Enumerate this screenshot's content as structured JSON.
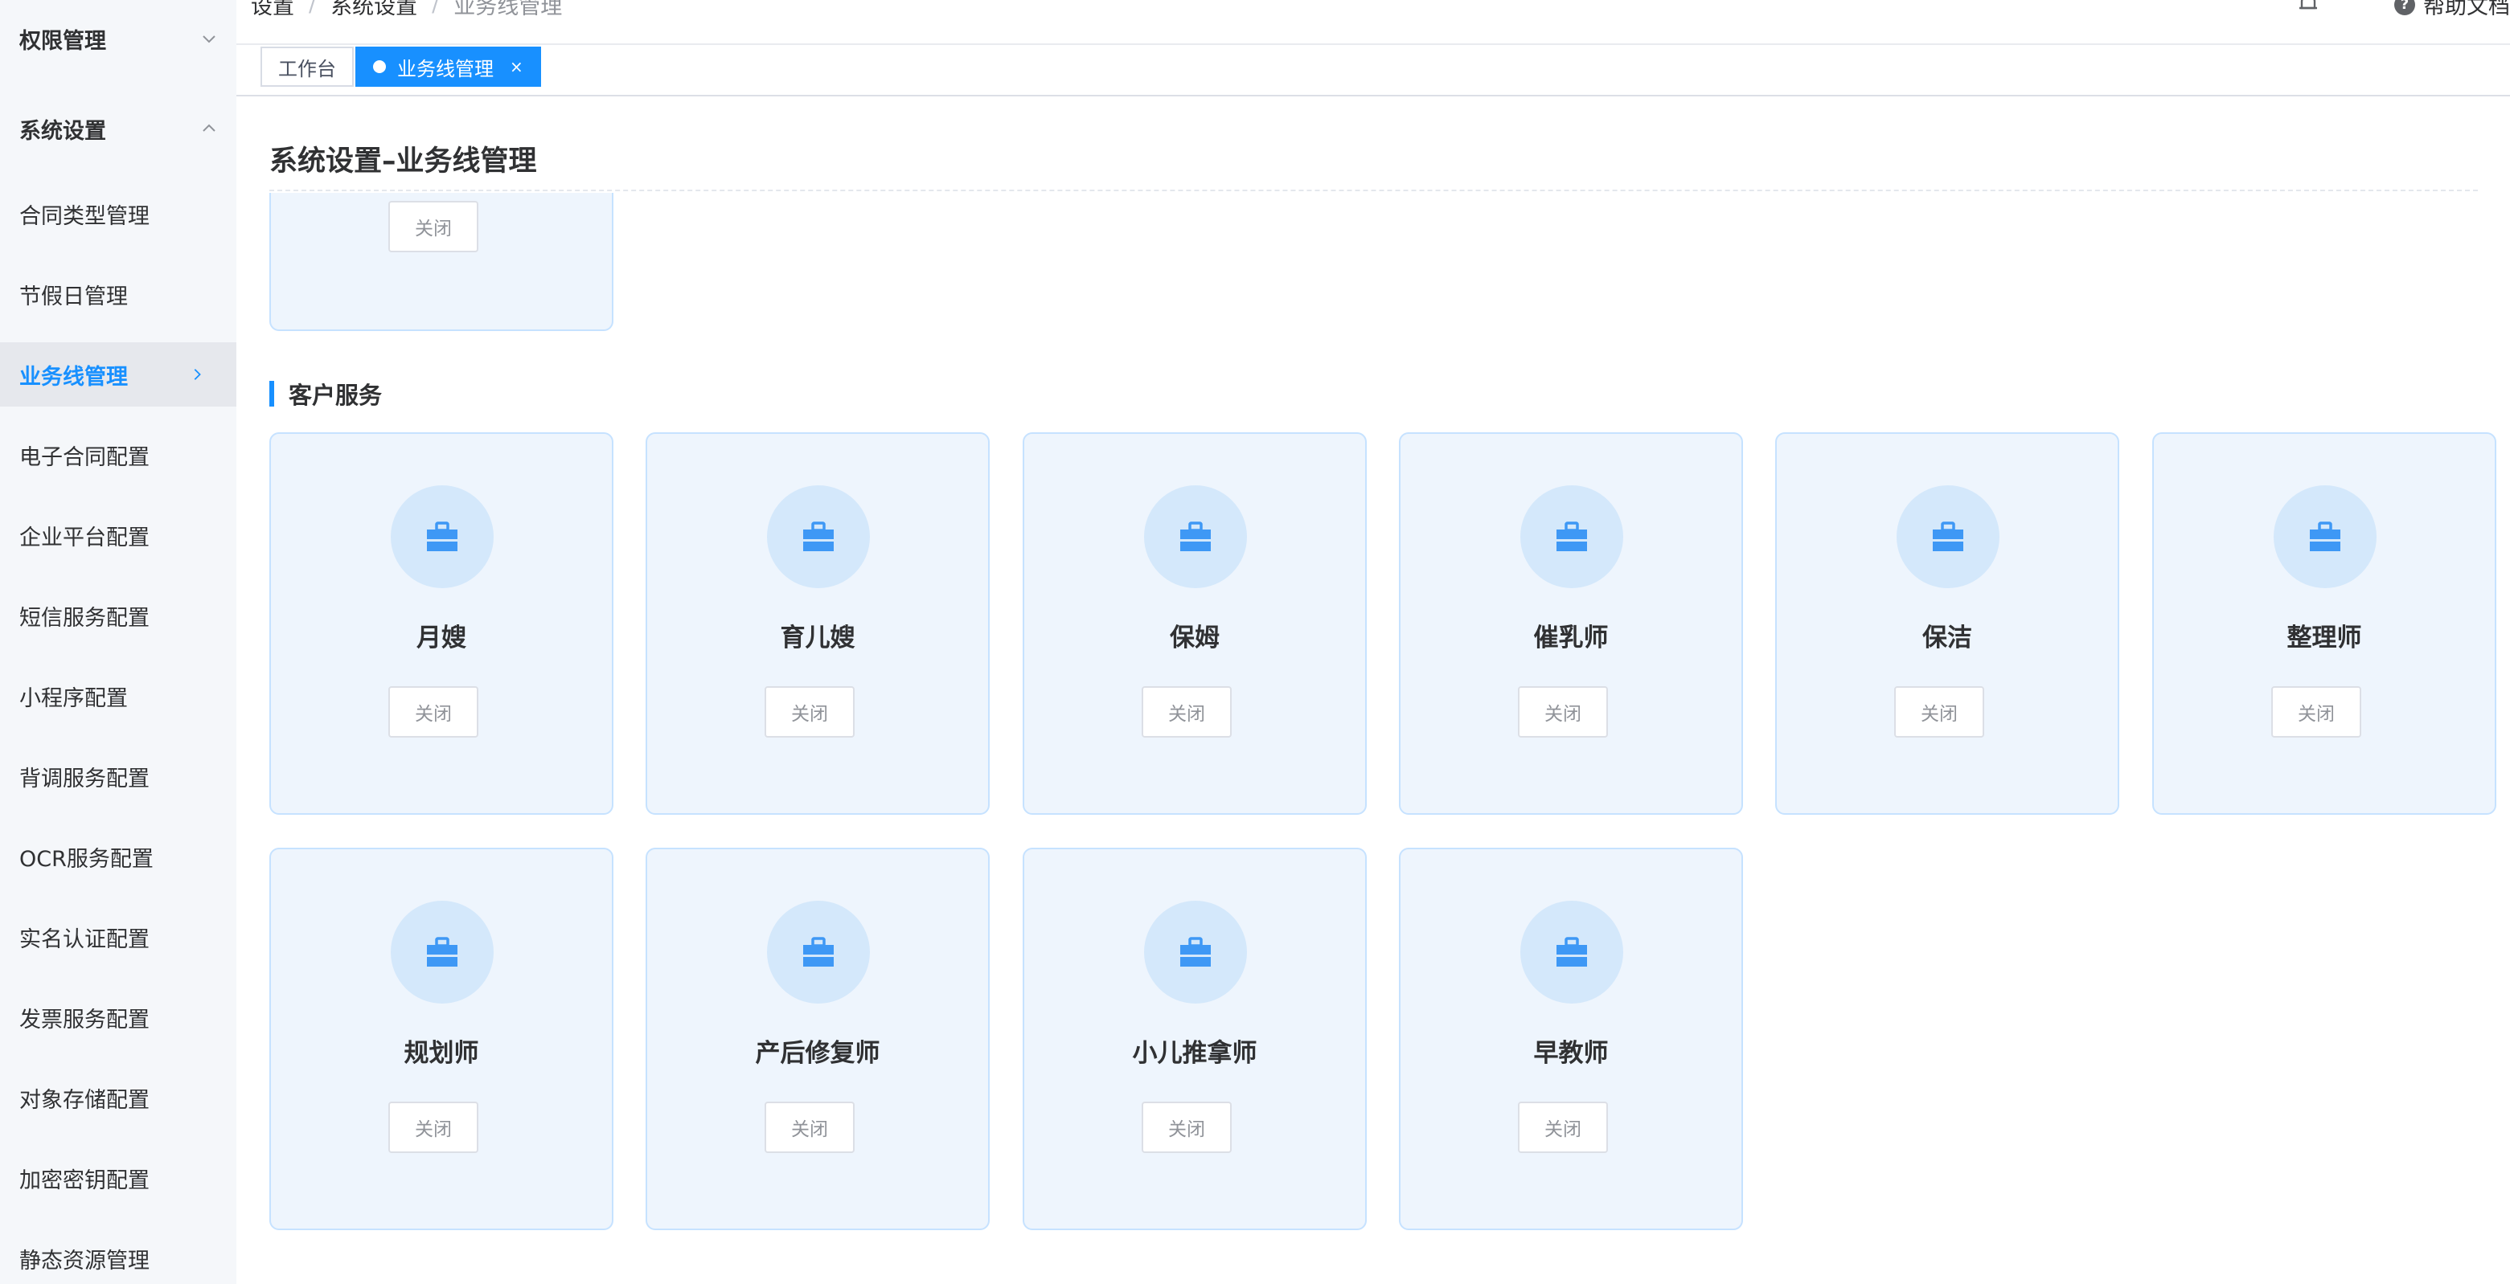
{
  "sidebar": {
    "groups": [
      {
        "label": "权限管理",
        "state": "collapsed",
        "icon": "chevron-down-icon"
      },
      {
        "label": "系统设置",
        "state": "expanded",
        "icon": "chevron-up-icon"
      }
    ],
    "items": [
      {
        "label": "合同类型管理"
      },
      {
        "label": "节假日管理"
      },
      {
        "label": "业务线管理",
        "active": true,
        "icon": "chevron-right-icon"
      },
      {
        "label": "电子合同配置"
      },
      {
        "label": "企业平台配置"
      },
      {
        "label": "短信服务配置"
      },
      {
        "label": "小程序配置"
      },
      {
        "label": "背调服务配置"
      },
      {
        "label": "OCR服务配置"
      },
      {
        "label": "实名认证配置"
      },
      {
        "label": "发票服务配置"
      },
      {
        "label": "对象存储配置"
      },
      {
        "label": "加密密钥配置"
      },
      {
        "label": "静态资源管理"
      }
    ]
  },
  "header": {
    "breadcrumb": [
      "设置",
      "系统设置",
      "业务线管理"
    ],
    "breadcrumb_separator": "/",
    "bell_icon": "bell-icon",
    "help_icon": "question-circle-icon",
    "help_label": "帮助文档"
  },
  "tabs": [
    {
      "label": "工作台",
      "active": false
    },
    {
      "label": "业务线管理",
      "active": true,
      "close_label": "×"
    }
  ],
  "main": {
    "title": "系统设置–业务线管理",
    "partial_card": {
      "button": "关闭"
    },
    "section": {
      "title": "客户服务",
      "cards": [
        {
          "name": "月嫂",
          "icon": "briefcase-icon",
          "button": "关闭"
        },
        {
          "name": "育儿嫂",
          "icon": "briefcase-icon",
          "button": "关闭"
        },
        {
          "name": "保姆",
          "icon": "briefcase-icon",
          "button": "关闭"
        },
        {
          "name": "催乳师",
          "icon": "briefcase-icon",
          "button": "关闭"
        },
        {
          "name": "保洁",
          "icon": "briefcase-icon",
          "button": "关闭"
        },
        {
          "name": "整理师",
          "icon": "briefcase-icon",
          "button": "关闭"
        },
        {
          "name": "规划师",
          "icon": "briefcase-icon",
          "button": "关闭"
        },
        {
          "name": "产后修复师",
          "icon": "briefcase-icon",
          "button": "关闭"
        },
        {
          "name": "小儿推拿师",
          "icon": "briefcase-icon",
          "button": "关闭"
        },
        {
          "name": "早教师",
          "icon": "briefcase-icon",
          "button": "关闭"
        }
      ]
    }
  },
  "colors": {
    "accent": "#1890ff",
    "card_bg": "#eef5fd",
    "card_border": "#c6e2ff",
    "icon_bg": "#d4e8fb",
    "icon_fg": "#3e98f5",
    "sidebar_bg": "#f5f7fa"
  }
}
